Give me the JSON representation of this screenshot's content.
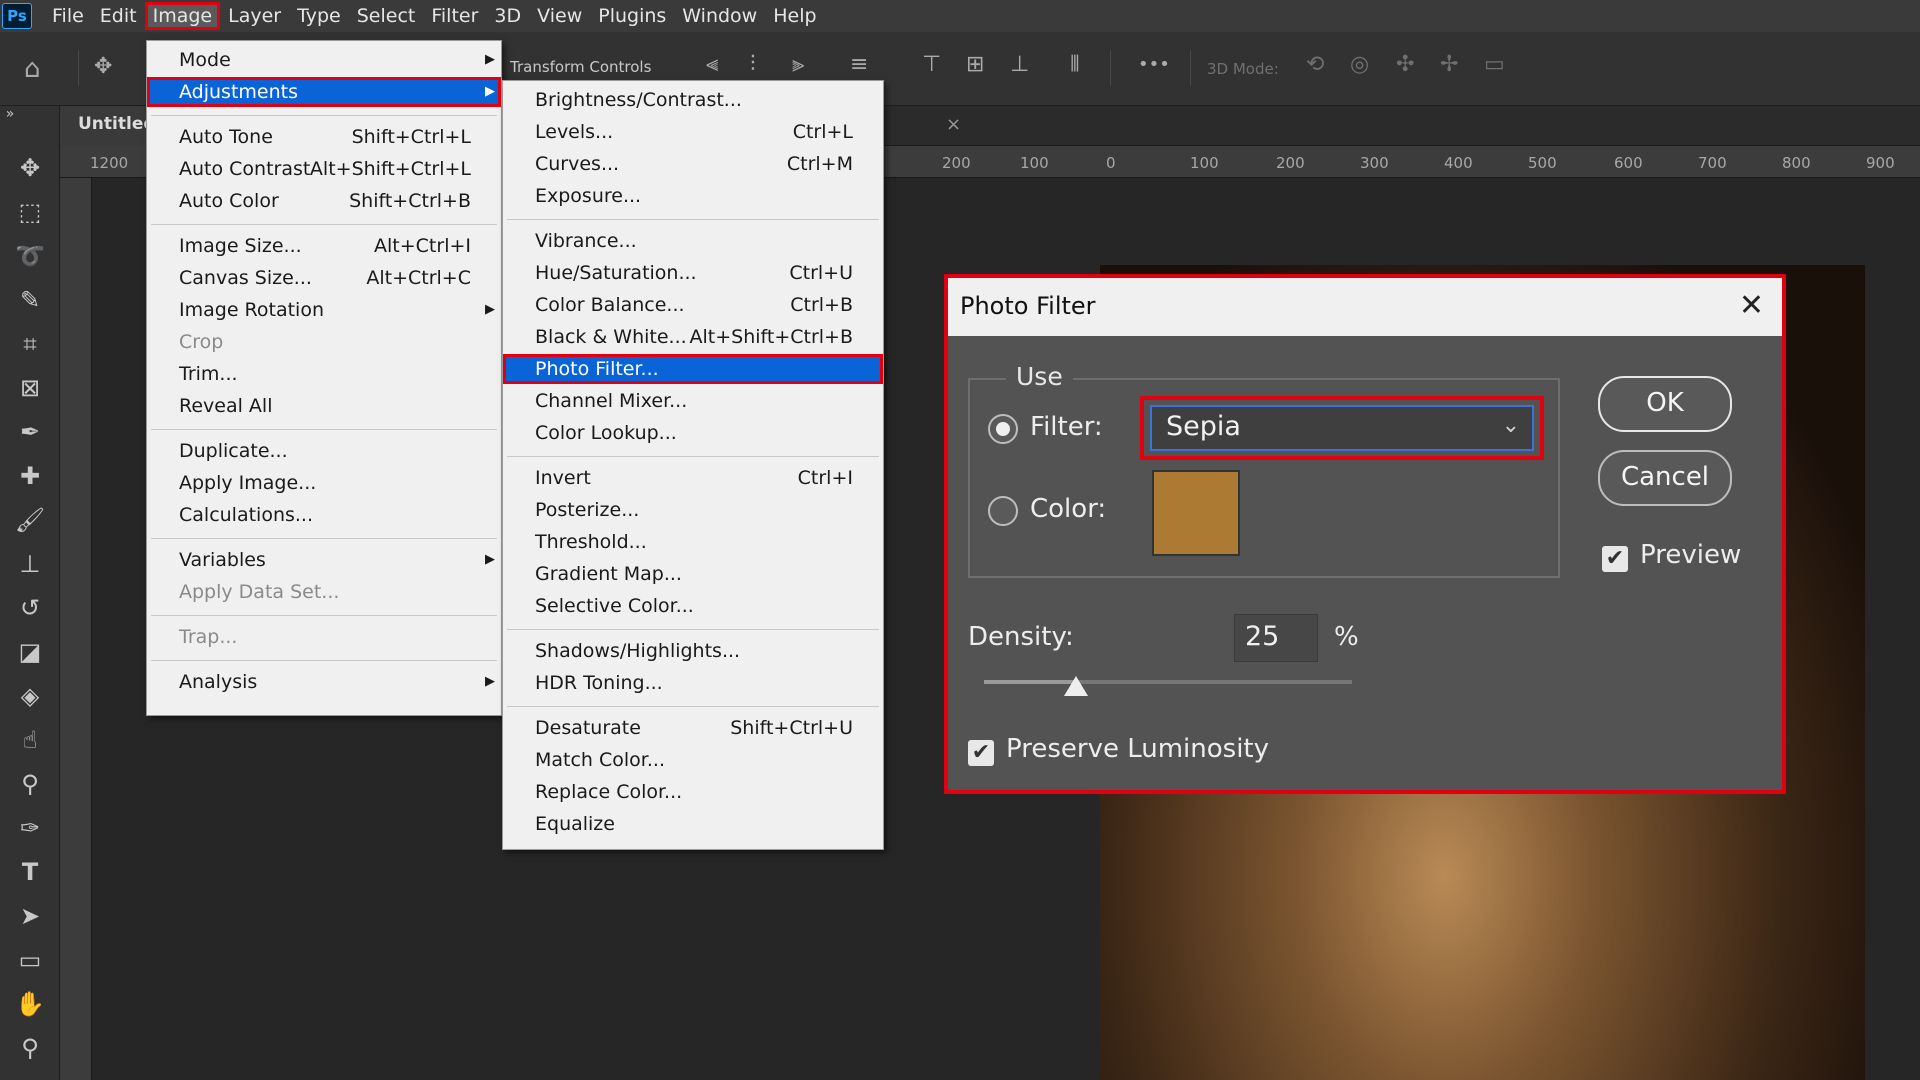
{
  "app": {
    "logo": "Ps",
    "document_tab": "Untitled",
    "tab_close": "×"
  },
  "menubar": [
    "File",
    "Edit",
    "Image",
    "Layer",
    "Type",
    "Select",
    "Filter",
    "3D",
    "View",
    "Plugins",
    "Window",
    "Help"
  ],
  "menubar_active": "Image",
  "options_bar": {
    "transform_controls": "Transform Controls",
    "mode_3d": "3D Mode:",
    "more": "•••"
  },
  "ruler_ticks": [
    "1200",
    "200",
    "100",
    "0",
    "100",
    "200",
    "300",
    "400",
    "500",
    "600",
    "700",
    "800",
    "900"
  ],
  "image_menu": [
    {
      "label": "Mode",
      "submenu": true
    },
    {
      "label": "Adjustments",
      "submenu": true,
      "highlight": true
    },
    {
      "sep": true
    },
    {
      "label": "Auto Tone",
      "shortcut": "Shift+Ctrl+L"
    },
    {
      "label": "Auto Contrast",
      "shortcut": "Alt+Shift+Ctrl+L"
    },
    {
      "label": "Auto Color",
      "shortcut": "Shift+Ctrl+B"
    },
    {
      "sep": true
    },
    {
      "label": "Image Size...",
      "shortcut": "Alt+Ctrl+I"
    },
    {
      "label": "Canvas Size...",
      "shortcut": "Alt+Ctrl+C"
    },
    {
      "label": "Image Rotation",
      "submenu": true
    },
    {
      "label": "Crop",
      "disabled": true
    },
    {
      "label": "Trim..."
    },
    {
      "label": "Reveal All"
    },
    {
      "sep": true
    },
    {
      "label": "Duplicate..."
    },
    {
      "label": "Apply Image..."
    },
    {
      "label": "Calculations..."
    },
    {
      "sep": true
    },
    {
      "label": "Variables",
      "submenu": true
    },
    {
      "label": "Apply Data Set...",
      "disabled": true
    },
    {
      "sep": true
    },
    {
      "label": "Trap...",
      "disabled": true
    },
    {
      "sep": true
    },
    {
      "label": "Analysis",
      "submenu": true
    }
  ],
  "adjustments_menu": [
    {
      "label": "Brightness/Contrast..."
    },
    {
      "label": "Levels...",
      "shortcut": "Ctrl+L"
    },
    {
      "label": "Curves...",
      "shortcut": "Ctrl+M"
    },
    {
      "label": "Exposure..."
    },
    {
      "sep": true
    },
    {
      "label": "Vibrance..."
    },
    {
      "label": "Hue/Saturation...",
      "shortcut": "Ctrl+U"
    },
    {
      "label": "Color Balance...",
      "shortcut": "Ctrl+B"
    },
    {
      "label": "Black & White...",
      "shortcut": "Alt+Shift+Ctrl+B"
    },
    {
      "label": "Photo Filter...",
      "highlight": true
    },
    {
      "label": "Channel Mixer..."
    },
    {
      "label": "Color Lookup..."
    },
    {
      "sep": true
    },
    {
      "label": "Invert",
      "shortcut": "Ctrl+I"
    },
    {
      "label": "Posterize..."
    },
    {
      "label": "Threshold..."
    },
    {
      "label": "Gradient Map..."
    },
    {
      "label": "Selective Color..."
    },
    {
      "sep": true
    },
    {
      "label": "Shadows/Highlights..."
    },
    {
      "label": "HDR Toning..."
    },
    {
      "sep": true
    },
    {
      "label": "Desaturate",
      "shortcut": "Shift+Ctrl+U"
    },
    {
      "label": "Match Color..."
    },
    {
      "label": "Replace Color..."
    },
    {
      "label": "Equalize"
    }
  ],
  "dialog": {
    "title": "Photo Filter",
    "close": "✕",
    "use_label": "Use",
    "filter_label": "Filter:",
    "filter_value": "Sepia",
    "filter_selected": true,
    "color_label": "Color:",
    "color_value": "#ac7a33",
    "ok_label": "OK",
    "cancel_label": "Cancel",
    "preview_label": "Preview",
    "preview_checked": true,
    "density_label": "Density:",
    "density_value": "25",
    "density_unit": "%",
    "density_percent": 25,
    "preserve_label": "Preserve Luminosity",
    "preserve_checked": true
  },
  "colors": {
    "highlight_outline": "#e0000f",
    "menu_selection": "#0a64d8",
    "accent_select": "#3a72d8"
  }
}
